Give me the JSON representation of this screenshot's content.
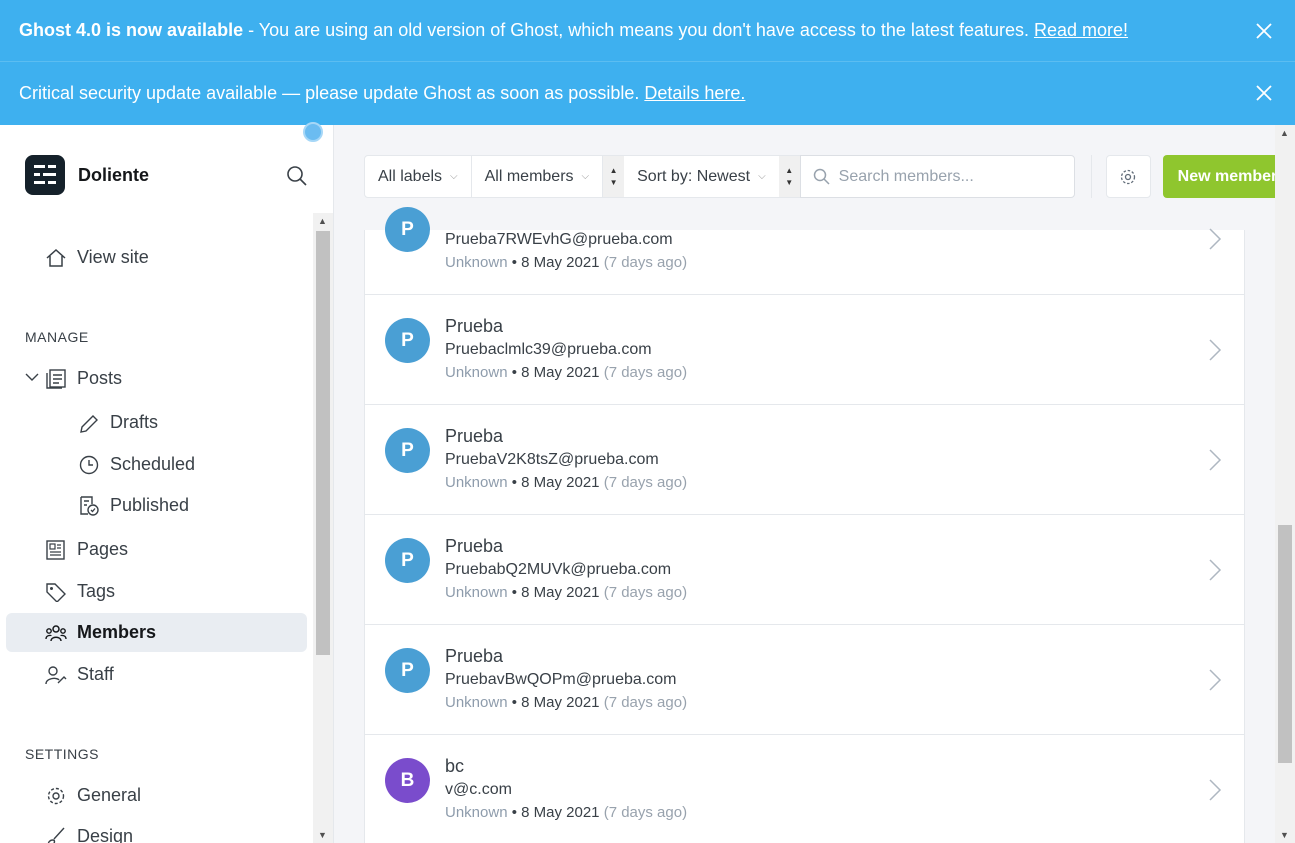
{
  "banners": {
    "update": {
      "title": "Ghost 4.0 is now available",
      "text": " - You are using an old version of Ghost, which means you don't have access to the latest features. ",
      "link": "Read more!"
    },
    "security": {
      "text": "Critical security update available — please update Ghost as soon as possible. ",
      "link": "Details here."
    }
  },
  "sidebar": {
    "site_name": "Doliente",
    "view_site": "View site",
    "manage_label": "MANAGE",
    "posts": "Posts",
    "drafts": "Drafts",
    "scheduled": "Scheduled",
    "published": "Published",
    "pages": "Pages",
    "tags": "Tags",
    "members": "Members",
    "staff": "Staff",
    "settings_label": "SETTINGS",
    "general": "General",
    "design": "Design"
  },
  "toolbar": {
    "labels_filter": "All labels",
    "members_filter": "All members",
    "sort": "Sort by: Newest",
    "search_placeholder": "Search members...",
    "new_member": "New member"
  },
  "members": [
    {
      "name": "",
      "initial": "P",
      "email": "Prueba7RWEvhG@prueba.com",
      "source": "Unknown",
      "date": "8 May 2021",
      "ago": "(7 days ago)",
      "color": "#4a9fd4"
    },
    {
      "name": "Prueba",
      "initial": "P",
      "email": "Pruebaclmlc39@prueba.com",
      "source": "Unknown",
      "date": "8 May 2021",
      "ago": "(7 days ago)",
      "color": "#4a9fd4"
    },
    {
      "name": "Prueba",
      "initial": "P",
      "email": "PruebaV2K8tsZ@prueba.com",
      "source": "Unknown",
      "date": "8 May 2021",
      "ago": "(7 days ago)",
      "color": "#4a9fd4"
    },
    {
      "name": "Prueba",
      "initial": "P",
      "email": "PruebabQ2MUVk@prueba.com",
      "source": "Unknown",
      "date": "8 May 2021",
      "ago": "(7 days ago)",
      "color": "#4a9fd4"
    },
    {
      "name": "Prueba",
      "initial": "P",
      "email": "PruebavBwQOPm@prueba.com",
      "source": "Unknown",
      "date": "8 May 2021",
      "ago": "(7 days ago)",
      "color": "#4a9fd4"
    },
    {
      "name": "bc",
      "initial": "B",
      "email": "v@c.com",
      "source": "Unknown",
      "date": "8 May 2021",
      "ago": "(7 days ago)",
      "color": "#7a4ccc"
    }
  ],
  "meta_separator": " • "
}
